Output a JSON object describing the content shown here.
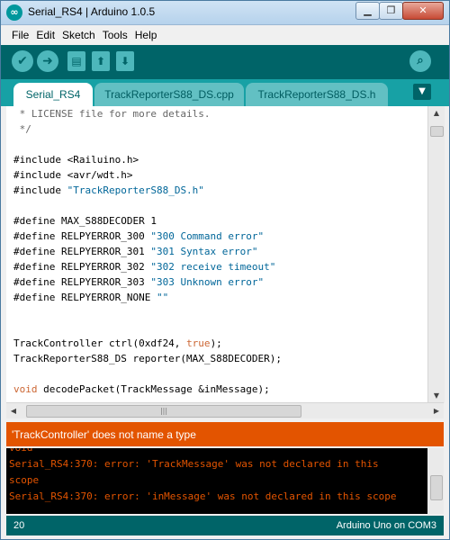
{
  "window": {
    "title": "Serial_RS4 | Arduino 1.0.5",
    "app_icon": "arduino-logo-icon",
    "buttons": {
      "minimize": "▁",
      "maximize": "❐",
      "close": "✕"
    }
  },
  "menu": [
    "File",
    "Edit",
    "Sketch",
    "Tools",
    "Help"
  ],
  "toolbar": {
    "verify_icon": "✔",
    "upload_icon": "➜",
    "new_icon": "▤",
    "open_icon": "⬆",
    "save_icon": "⬇",
    "monitor_icon": "⌕"
  },
  "tabs": {
    "items": [
      "Serial_RS4",
      "TrackReporterS88_DS.cpp",
      "TrackReporterS88_DS.h"
    ],
    "menu_icon": "▼"
  },
  "editor": {
    "lines": [
      [
        {
          "t": " * LICENSE file for more details.",
          "c": "comment"
        }
      ],
      [
        {
          "t": " */",
          "c": "comment"
        }
      ],
      [],
      [
        {
          "t": "#include <Railuino.h>",
          "c": ""
        }
      ],
      [
        {
          "t": "#include <avr/wdt.h>",
          "c": ""
        }
      ],
      [
        {
          "t": "#include ",
          "c": ""
        },
        {
          "t": "\"TrackReporterS88_DS.h\"",
          "c": "string"
        }
      ],
      [],
      [
        {
          "t": "#define MAX_S88DECODER 1",
          "c": ""
        }
      ],
      [
        {
          "t": "#define RELPYERROR_300 ",
          "c": ""
        },
        {
          "t": "\"300 Command error\"",
          "c": "string"
        }
      ],
      [
        {
          "t": "#define RELPYERROR_301 ",
          "c": ""
        },
        {
          "t": "\"301 Syntax error\"",
          "c": "string"
        }
      ],
      [
        {
          "t": "#define RELPYERROR_302 ",
          "c": ""
        },
        {
          "t": "\"302 receive timeout\"",
          "c": "string"
        }
      ],
      [
        {
          "t": "#define RELPYERROR_303 ",
          "c": ""
        },
        {
          "t": "\"303 Unknown error\"",
          "c": "string"
        }
      ],
      [
        {
          "t": "#define RELPYERROR_NONE ",
          "c": ""
        },
        {
          "t": "\"\"",
          "c": "string"
        }
      ],
      [],
      [],
      [
        {
          "t": "TrackController ctrl(0xdf24, ",
          "c": ""
        },
        {
          "t": "true",
          "c": "keyword"
        },
        {
          "t": ");",
          "c": ""
        }
      ],
      [
        {
          "t": "TrackReporterS88_DS reporter(MAX_S88DECODER);",
          "c": ""
        }
      ],
      [],
      [
        {
          "t": "void",
          "c": "keyword"
        },
        {
          "t": " decodePacket(TrackMessage &inMessage);",
          "c": ""
        }
      ]
    ]
  },
  "scrollbars": {
    "up_arrow": "▲",
    "down_arrow": "▼",
    "left_arrow": "◀",
    "right_arrow": "▶",
    "grip": "|||"
  },
  "message": "'TrackController' does not name a type",
  "console": [
    "void",
    "Serial_RS4:370: error: 'TrackMessage' was not declared in this",
    "scope",
    "Serial_RS4:370: error: 'inMessage' was not declared in this scope"
  ],
  "status": {
    "line": "20",
    "board": "Arduino Uno on COM3"
  }
}
